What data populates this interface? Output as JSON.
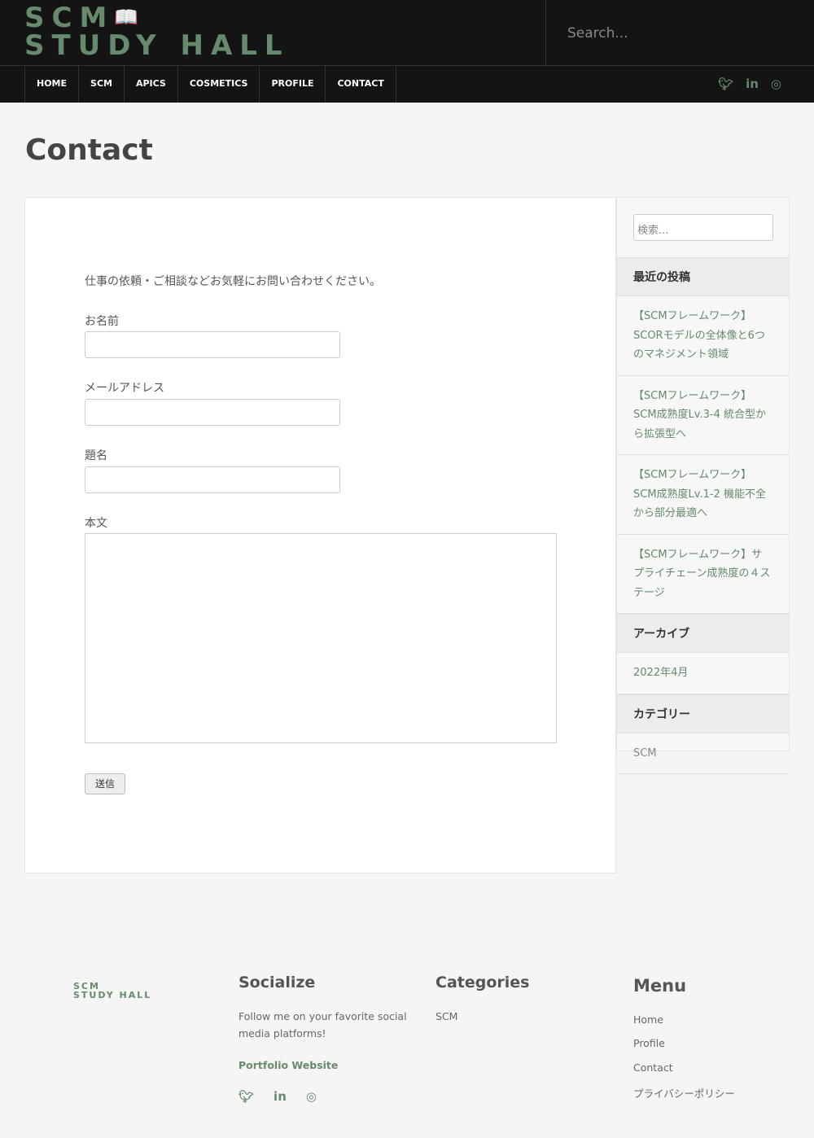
{
  "header": {
    "logo_line1": "SCM",
    "logo_line2": "STUDY HALL",
    "search_placeholder": "Search..."
  },
  "nav": [
    "HOME",
    "SCM",
    "APICS",
    "COSMETICS",
    "PROFILE",
    "CONTACT"
  ],
  "social_icons": [
    "twitter-icon",
    "linkedin-icon",
    "instagram-icon"
  ],
  "page": {
    "title": "Contact"
  },
  "form": {
    "intro": "仕事の依頼・ご相談などお気軽にお問い合わせください。",
    "name_label": "お名前",
    "email_label": "メールアドレス",
    "subject_label": "題名",
    "body_label": "本文",
    "submit": "送信"
  },
  "sidebar": {
    "search_placeholder": "検索...",
    "recent_title": "最近の投稿",
    "recent": [
      "【SCMフレームワーク】SCORモデルの全体像と6つのマネジメント領域",
      "【SCMフレームワーク】SCM成熟度Lv.3-4 統合型から拡張型へ",
      "【SCMフレームワーク】SCM成熟度Lv.1-2 機能不全から部分最適へ",
      "【SCMフレームワーク】サプライチェーン成熟度の４ステージ"
    ],
    "archive_title": "アーカイブ",
    "archives": [
      "2022年4月"
    ],
    "category_title": "カテゴリー",
    "categories": [
      "SCM"
    ]
  },
  "footer": {
    "logo_line1": "SCM",
    "logo_line2": "STUDY HALL",
    "socialize_title": "Socialize",
    "socialize_text": "Follow me on your favorite social media platforms!",
    "portfolio": "Portfolio Website",
    "categories_title": "Categories",
    "categories": [
      "SCM"
    ],
    "menu_title": "Menu",
    "menu": [
      "Home",
      "Profile",
      "Contact",
      "プライバシーポリシー"
    ]
  },
  "colors": {
    "accent": "#668a6c",
    "header_bg": "#141414"
  }
}
